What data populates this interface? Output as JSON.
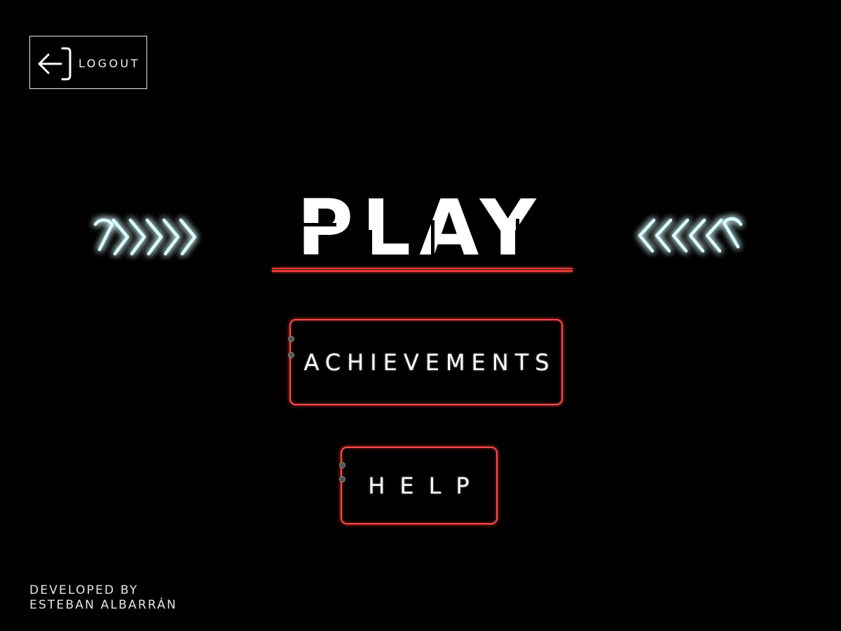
{
  "logout": {
    "label": "LOGOUT",
    "icon": "logout-icon"
  },
  "menu": {
    "play_label": "PLAY",
    "achievements_label": "ACHIEVEMENTS",
    "help_label": "HELP"
  },
  "decor": {
    "left_arrows_icon": "chevrons-right-icon",
    "right_arrows_icon": "chevrons-left-icon",
    "arrow_color": "#bff4ff",
    "arrow_glow": "#5fd6ee",
    "neon_red": "#ff4a4a"
  },
  "credits": {
    "line1": "DEVELOPED BY",
    "line2": "ESTEBAN ALBARRÁN"
  }
}
